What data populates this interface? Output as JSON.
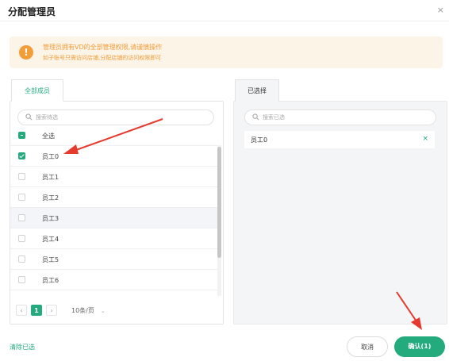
{
  "dialog": {
    "title": "分配管理员",
    "close": "×"
  },
  "alert": {
    "line1": "管理员拥有VD的全部管理权限,请谨慎操作",
    "line2": "如子账号只需访问店铺,分配店铺的访问权限即可",
    "color": "#f29d38"
  },
  "left": {
    "tab": "全部成员",
    "search_placeholder": "搜索待选",
    "select_all": "全选",
    "items": [
      {
        "label": "员工0",
        "checked": true
      },
      {
        "label": "员工1",
        "checked": false
      },
      {
        "label": "员工2",
        "checked": false
      },
      {
        "label": "员工3",
        "checked": false
      },
      {
        "label": "员工4",
        "checked": false
      },
      {
        "label": "员工5",
        "checked": false
      },
      {
        "label": "员工6",
        "checked": false
      }
    ],
    "pagination": {
      "prev": "‹",
      "page": "1",
      "next": "›",
      "page_size": "10条/页"
    }
  },
  "right": {
    "tab": "已选择",
    "search_placeholder": "搜索已选",
    "selected": [
      {
        "label": "员工0",
        "remove": "×"
      }
    ]
  },
  "footer": {
    "clear": "清除已选",
    "cancel": "取消",
    "confirm": "确认(1)"
  },
  "colors": {
    "accent": "#23ab7e",
    "annotation_arrow": "#e63a2e"
  }
}
